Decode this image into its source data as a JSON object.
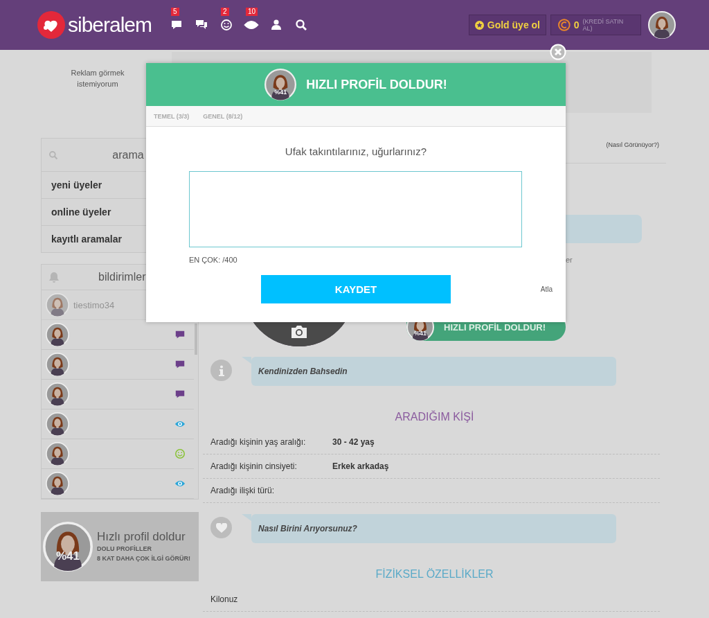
{
  "header": {
    "logo": "siberalem",
    "nav_icons": [
      {
        "kind": "message",
        "badge": "5"
      },
      {
        "kind": "chat"
      },
      {
        "kind": "smile",
        "badge": "2"
      },
      {
        "kind": "eye",
        "badge": "10"
      },
      {
        "kind": "user"
      },
      {
        "kind": "search"
      }
    ],
    "gold_button": "Gold üye ol",
    "credit": {
      "amount": "0",
      "label": "(KREDİ SATIN AL)"
    }
  },
  "ad_note": "Reklam görmek istemiyorum",
  "sidebar": {
    "search": "arama",
    "links": [
      "yeni üyeler",
      "online üyeler",
      "kayıtlı aramalar"
    ],
    "notifications": {
      "title": "bildirimler",
      "items": [
        {
          "name": "tiestimo34",
          "faded": true,
          "kind": "none"
        },
        {
          "faded": false,
          "kind": "message"
        },
        {
          "faded": false,
          "kind": "message"
        },
        {
          "faded": false,
          "kind": "message"
        },
        {
          "faded": false,
          "kind": "view"
        },
        {
          "faded": false,
          "kind": "smile"
        },
        {
          "faded": false,
          "kind": "view"
        }
      ]
    }
  },
  "promo": {
    "title": "Hızlı profil doldur",
    "lines": [
      "DOLU PROFİLLER",
      "8 KAT DAHA ÇOK İLGİ GÖRÜR!"
    ],
    "percent": "%41"
  },
  "profile": {
    "preview_link": "(Nasıl Görünüyor?)",
    "partial_text": "er",
    "fill_button": "HIZLI PROFİL DOLDUR!",
    "fill_percent": "%41",
    "about_prompt": "Kendinizden Bahsedin",
    "sections": [
      {
        "title": "ARADIĞIM KİŞİ",
        "color": "#8a5a9e",
        "rows": [
          {
            "label": "Aradığı kişinin yaş aralığı:",
            "value": "30 - 42 yaş"
          },
          {
            "label": "Aradığı kişinin cinsiyeti:",
            "value": "Erkek arkadaş"
          },
          {
            "label": "Aradığı ilişki türü:"
          }
        ],
        "prompt": "Nasıl Birini Arıyorsunuz?"
      },
      {
        "title": "FİZİKSEL ÖZELLİKLER",
        "color": "#5aaac8",
        "rows": [
          {
            "label": "Kilonuz"
          }
        ]
      }
    ]
  },
  "modal": {
    "title": "HIZLI PROFİL DOLDUR!",
    "percent": "%41",
    "tabs": [
      "TEMEL (3/3)",
      "GENEL (8/12)"
    ],
    "question": "Ufak takıntılarınız, uğurlarınız?",
    "limit": "EN ÇOK: /400",
    "save": "KAYDET",
    "skip": "Atla"
  }
}
